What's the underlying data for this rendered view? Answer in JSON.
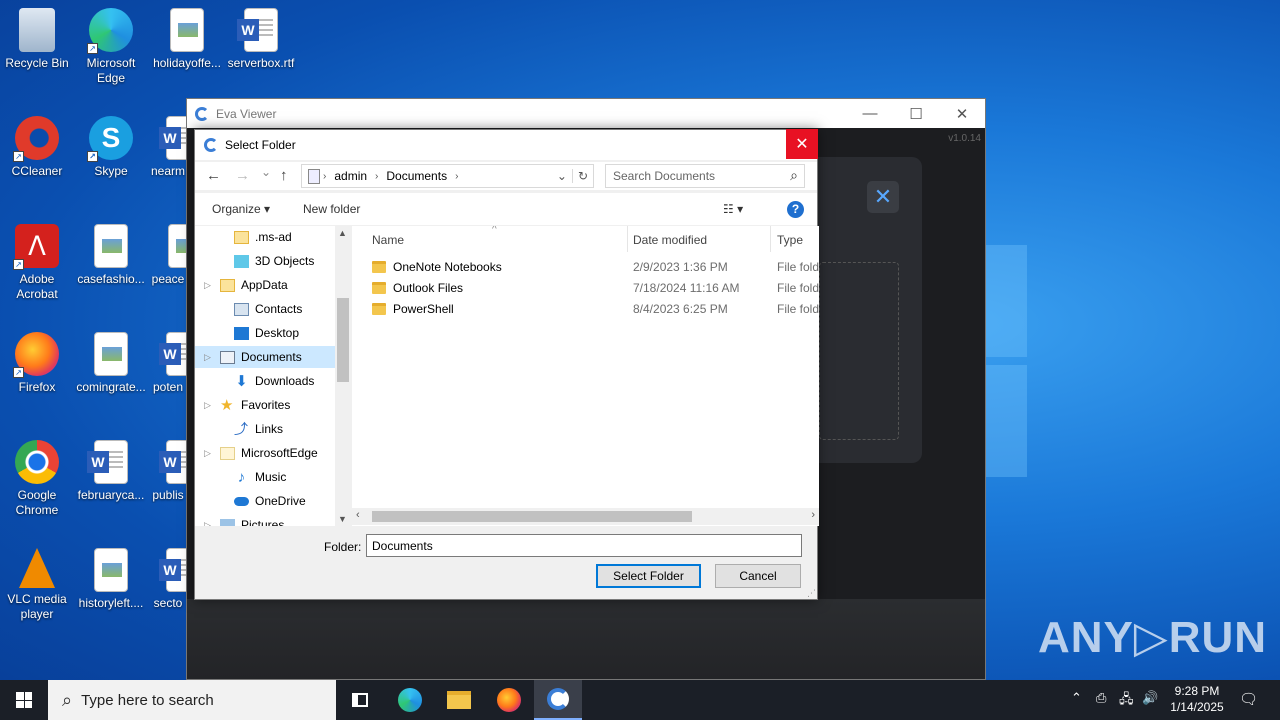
{
  "desktop": {
    "icons": [
      {
        "label": "Recycle Bin"
      },
      {
        "label": "Microsoft Edge"
      },
      {
        "label": "holidayoffe..."
      },
      {
        "label": "serverbox.rtf"
      },
      {
        "label": "CCleaner"
      },
      {
        "label": "Skype"
      },
      {
        "label": "nearm"
      },
      {
        "label": "Adobe Acrobat"
      },
      {
        "label": "casefashio..."
      },
      {
        "label": "peace"
      },
      {
        "label": "Firefox"
      },
      {
        "label": "comingrate..."
      },
      {
        "label": "poten"
      },
      {
        "label": "Google Chrome"
      },
      {
        "label": "februaryca..."
      },
      {
        "label": "publis"
      },
      {
        "label": "VLC media player"
      },
      {
        "label": "historyleft...."
      },
      {
        "label": "secto"
      }
    ]
  },
  "app": {
    "title": "Eva Viewer",
    "version": "v1.0.14",
    "minimize": "—",
    "maximize": "☐",
    "close": "✕",
    "panel_close": "✕"
  },
  "dialog": {
    "title": "Select Folder",
    "close": "✕",
    "nav": {
      "back": "←",
      "forward": "→",
      "recent": "⌄",
      "up": "↑",
      "refresh": "↻"
    },
    "address": {
      "segments": [
        "admin",
        "Documents"
      ],
      "dropdown": "⌄"
    },
    "search_placeholder": "Search Documents",
    "search_icon": "⌕",
    "toolbar": {
      "organize": "Organize ▾",
      "new_folder": "New folder",
      "view": "☷ ▾",
      "help": "?"
    },
    "tree": [
      {
        "label": ".ms-ad",
        "expander": false,
        "icon": "folder"
      },
      {
        "label": "3D Objects",
        "expander": false,
        "icon": "3d-objects"
      },
      {
        "label": "AppData",
        "expander": true,
        "icon": "folder"
      },
      {
        "label": "Contacts",
        "expander": false,
        "icon": "contacts"
      },
      {
        "label": "Desktop",
        "expander": false,
        "icon": "desktop"
      },
      {
        "label": "Documents",
        "expander": true,
        "icon": "documents",
        "selected": true
      },
      {
        "label": "Downloads",
        "expander": false,
        "icon": "downloads"
      },
      {
        "label": "Favorites",
        "expander": true,
        "icon": "star"
      },
      {
        "label": "Links",
        "expander": false,
        "icon": "links"
      },
      {
        "label": "MicrosoftEdge",
        "expander": true,
        "icon": "folder"
      },
      {
        "label": "Music",
        "expander": false,
        "icon": "music"
      },
      {
        "label": "OneDrive",
        "expander": false,
        "icon": "cloud"
      },
      {
        "label": "Pictures",
        "expander": true,
        "icon": "pictures"
      }
    ],
    "columns": {
      "name": "Name",
      "date": "Date modified",
      "type": "Type"
    },
    "files": [
      {
        "name": "OneNote Notebooks",
        "date": "2/9/2023 1:36 PM",
        "type": "File fold"
      },
      {
        "name": "Outlook Files",
        "date": "7/18/2024 11:16 AM",
        "type": "File fold"
      },
      {
        "name": "PowerShell",
        "date": "8/4/2023 6:25 PM",
        "type": "File fold"
      }
    ],
    "folder_label": "Folder:",
    "folder_value": "Documents",
    "select_button": "Select Folder",
    "cancel_button": "Cancel"
  },
  "taskbar": {
    "search_placeholder": "Type here to search",
    "time": "9:28 PM",
    "date": "1/14/2025"
  },
  "watermark": "ANY▷RUN"
}
